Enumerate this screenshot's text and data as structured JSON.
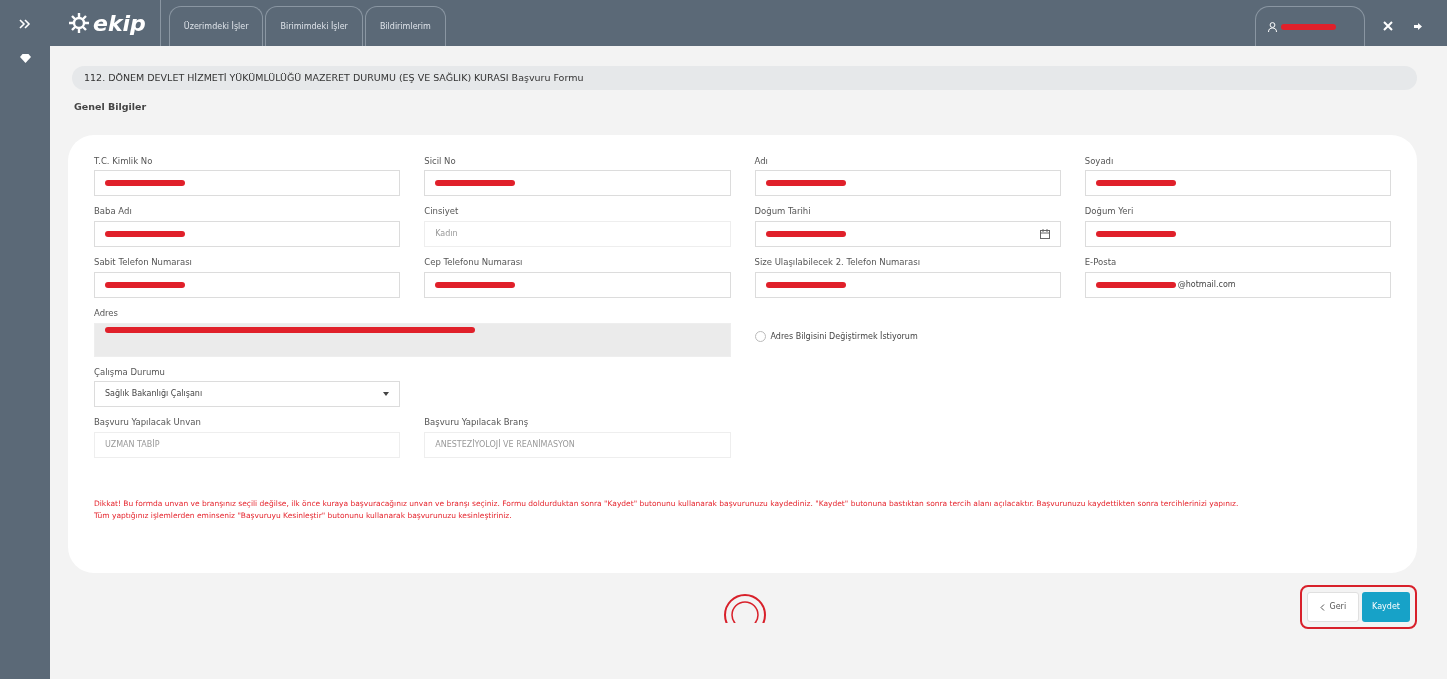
{
  "topbar": {
    "logo": "ekip",
    "tabs": [
      {
        "label": "Üzerimdeki İşler",
        "selected": false
      },
      {
        "label": "Birimimdeki İşler",
        "selected": false
      },
      {
        "label": "Bildirimlerim",
        "selected": false
      }
    ],
    "user": {
      "redacted": true
    }
  },
  "page_title": "112. DÖNEM DEVLET HİZMETİ YÜKÜMLÜLÜĞÜ MAZERET DURUMU (EŞ VE SAĞLIK) KURASI Başvuru Formu",
  "section_title": "Genel Bilgiler",
  "rows": [
    [
      {
        "kind": "text",
        "label": "T.C. Kimlik No",
        "redacted": true,
        "disabled": false
      },
      {
        "kind": "text",
        "label": "Sicil No",
        "redacted": true,
        "disabled": false
      },
      {
        "kind": "text",
        "label": "Adı",
        "redacted": true,
        "disabled": false
      },
      {
        "kind": "text",
        "label": "Soyadı",
        "redacted": true,
        "disabled": false
      }
    ],
    [
      {
        "kind": "text",
        "label": "Baba Adı",
        "redacted": true,
        "disabled": false
      },
      {
        "kind": "text",
        "label": "Cinsiyet",
        "value": "Kadın",
        "redacted": false,
        "disabled": true
      },
      {
        "kind": "date",
        "label": "Doğum Tarihi",
        "redacted": true,
        "disabled": false
      },
      {
        "kind": "text",
        "label": "Doğum Yeri",
        "redacted": true,
        "disabled": false
      }
    ],
    [
      {
        "kind": "text",
        "label": "Sabit Telefon Numarası",
        "redacted": true,
        "disabled": false
      },
      {
        "kind": "text",
        "label": "Cep Telefonu Numarası",
        "redacted": true,
        "disabled": false
      },
      {
        "kind": "text",
        "label": "Size Ulaşılabilecek 2. Telefon Numarası",
        "redacted": true,
        "disabled": false
      },
      {
        "kind": "text",
        "label": "E-Posta",
        "value": "@hotmail.com",
        "redacted": true,
        "disabled": false
      }
    ],
    [
      {
        "kind": "textarea",
        "label": "Adres",
        "redacted": true,
        "disabled": true
      },
      {
        "kind": "checkbox",
        "label": "Adres Bilgisini Değiştirmek İstiyorum",
        "checked": false
      }
    ],
    [
      {
        "kind": "select",
        "label": "Çalışma Durumu",
        "value": "Sağlık Bakanlığı Çalışanı",
        "redacted": false,
        "disabled": false
      }
    ],
    [
      {
        "kind": "text",
        "label": "Başvuru Yapılacak Unvan",
        "value": "UZMAN TABİP",
        "redacted": false,
        "disabled": true
      },
      {
        "kind": "text",
        "label": "Başvuru Yapılacak Branş",
        "value": "ANESTEZİYOLOJİ VE REANİMASYON",
        "redacted": false,
        "disabled": true
      }
    ]
  ],
  "notices": [
    "Dikkat! Bu formda unvan ve branşınız seçili değilse, ilk önce kuraya başvuracağınız unvan ve branşı seçiniz. Formu doldurduktan sonra \"Kaydet\" butonunu kullanarak başvurunuzu kaydediniz. \"Kaydet\" butonuna bastıktan sonra tercih alanı açılacaktır. Başvurunuzu kaydettikten sonra tercihlerinizi yapınız.",
    "Tüm yaptığınız işlemlerden eminseniz \"Başvuruyu Kesinleştir\" butonunu kullanarak başvurunuzu kesinleştiriniz."
  ],
  "buttons": [
    {
      "kind": "back",
      "label": "Geri"
    },
    {
      "kind": "primary",
      "label": "Kaydet"
    }
  ]
}
